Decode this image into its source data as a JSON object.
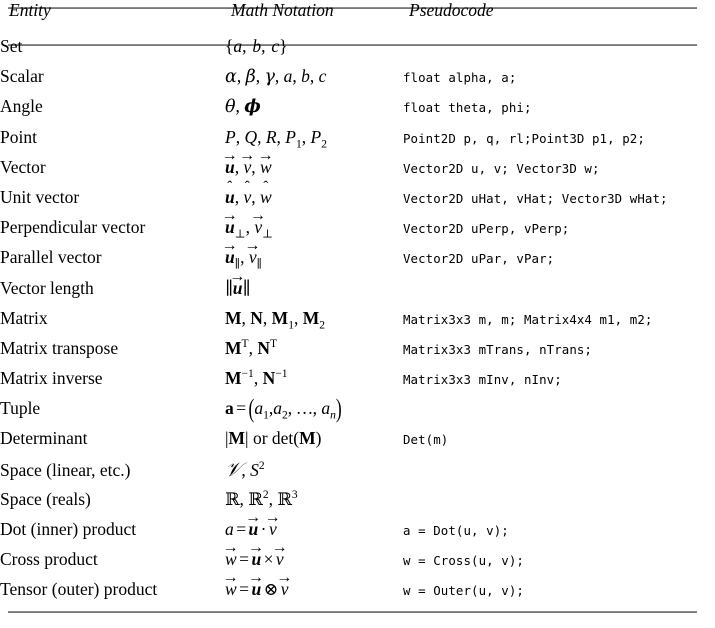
{
  "table": {
    "headers": {
      "entity": "Entity",
      "math": "Math Notation",
      "pseudocode": "Pseudocode"
    },
    "rows": [
      {
        "entity": "Set",
        "math_text": "{a, b, c}",
        "code": ""
      },
      {
        "entity": "Scalar",
        "math_text": "α, β, γ, a, b, c",
        "code": "float alpha, a;"
      },
      {
        "entity": "Angle",
        "math_text": "θ, ϕ",
        "code": "float theta, phi;"
      },
      {
        "entity": "Point",
        "math_text": "P, Q, R, P₁, P₂",
        "code": "Point2D p, q, rl;Point3D p1, p2;"
      },
      {
        "entity": "Vector",
        "math_text": "u⃗, v⃗, w⃗",
        "code": "Vector2D u, v; Vector3D w;"
      },
      {
        "entity": "Unit vector",
        "math_text": "û, v̂, ŵ",
        "code": "Vector2D uHat, vHat; Vector3D wHat;"
      },
      {
        "entity": "Perpendicular vector",
        "math_text": "u⃗⊥, v⃗⊥",
        "code": "Vector2D uPerp, vPerp;"
      },
      {
        "entity": "Parallel vector",
        "math_text": "u⃗∥, v⃗∥",
        "code": "Vector2D uPar, vPar;"
      },
      {
        "entity": "Vector length",
        "math_text": "‖u⃗‖",
        "code": ""
      },
      {
        "entity": "Matrix",
        "math_text": "M, N, M₁, M₂",
        "code": "Matrix3x3 m, m; Matrix4x4 m1, m2;"
      },
      {
        "entity": "Matrix transpose",
        "math_text": "Mᵀ, Nᵀ",
        "code": "Matrix3x3 mTrans, nTrans;"
      },
      {
        "entity": "Matrix inverse",
        "math_text": "M⁻¹, N⁻¹",
        "code": "Matrix3x3 mInv, nInv;"
      },
      {
        "entity": "Tuple",
        "math_text": "a = (a₁, a₂, ... , aₙ)",
        "code": ""
      },
      {
        "entity": "Determinant",
        "math_text": "|M| or det(M)",
        "code": "Det(m)"
      },
      {
        "entity": "Space (linear, etc.)",
        "math_text": "𝒱, S²",
        "code": ""
      },
      {
        "entity": "Space (reals)",
        "math_text": "ℝ, ℝ², ℝ³",
        "code": ""
      },
      {
        "entity": "Dot (inner) product",
        "math_text": "a = u⃗ · v⃗",
        "code": "a = Dot(u, v);"
      },
      {
        "entity": "Cross product",
        "math_text": "w⃗ = u⃗ × v⃗",
        "code": "w = Cross(u, v);"
      },
      {
        "entity": "Tensor (outer) product",
        "math_text": "w⃗ = u⃗ ⊗ v⃗",
        "code": "w = Outer(u, v);"
      }
    ]
  },
  "style": {
    "rule_color": "#777777",
    "text_color": "#000000",
    "background": "#ffffff"
  }
}
